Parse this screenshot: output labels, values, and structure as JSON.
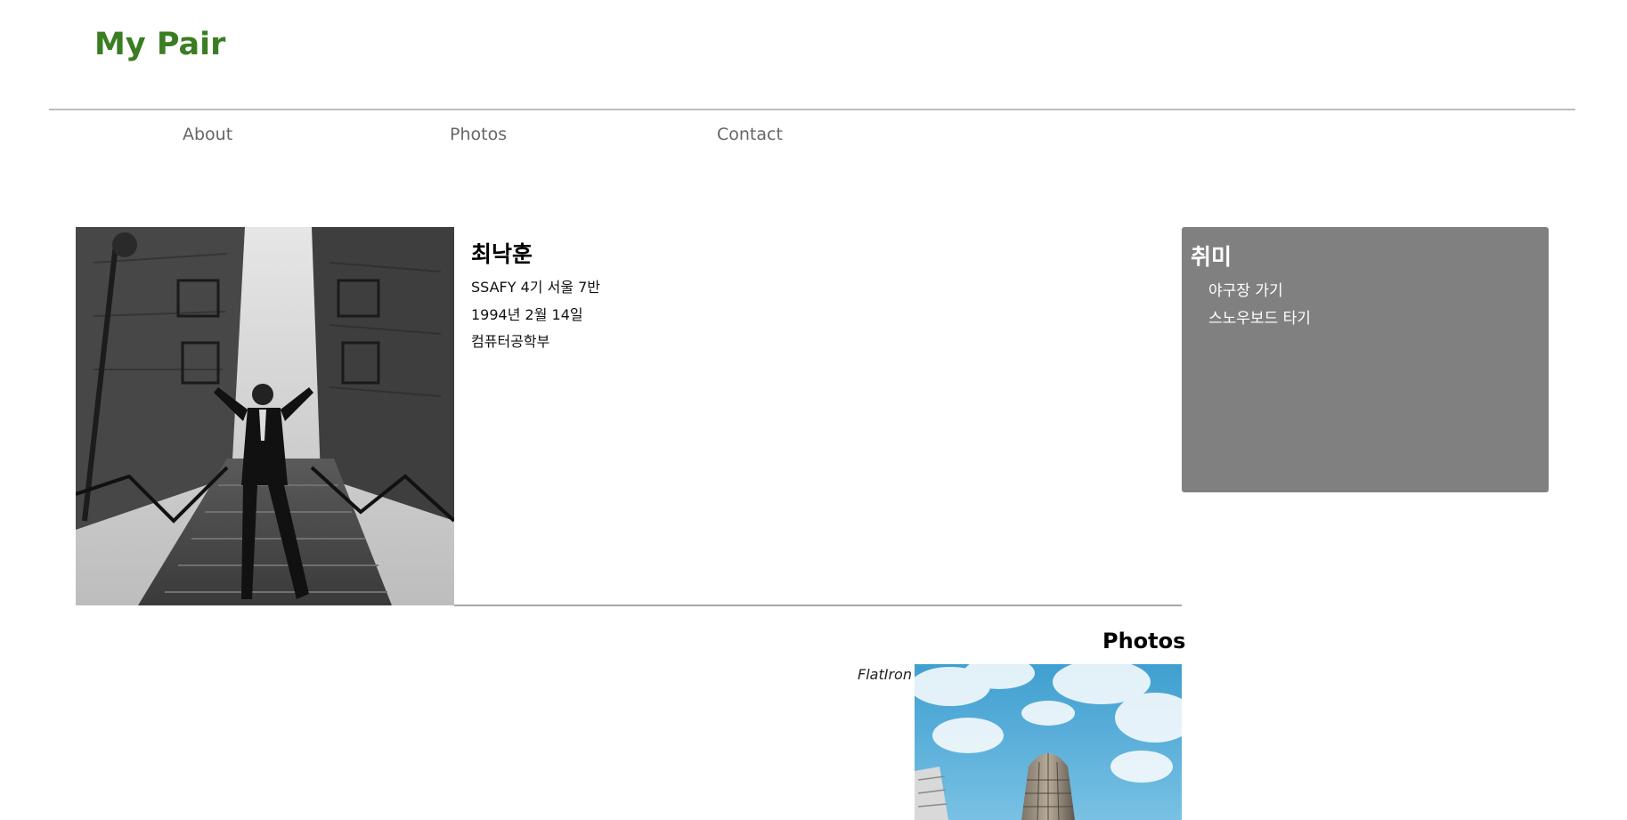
{
  "header": {
    "brand": "My Pair",
    "brand_color": "#3a7d22"
  },
  "nav": {
    "items": [
      {
        "label": "About"
      },
      {
        "label": "Photos"
      },
      {
        "label": "Contact"
      }
    ]
  },
  "profile": {
    "name": "최낙훈",
    "class": "SSAFY 4기 서울 7반",
    "birth": "1994년 2월 14일",
    "major": "컴퓨터공학부"
  },
  "hobby": {
    "title": "취미",
    "items": [
      "야구장 가기",
      "스노우보드 타기"
    ]
  },
  "photos": {
    "title": "Photos",
    "caption": "FlatIron"
  }
}
